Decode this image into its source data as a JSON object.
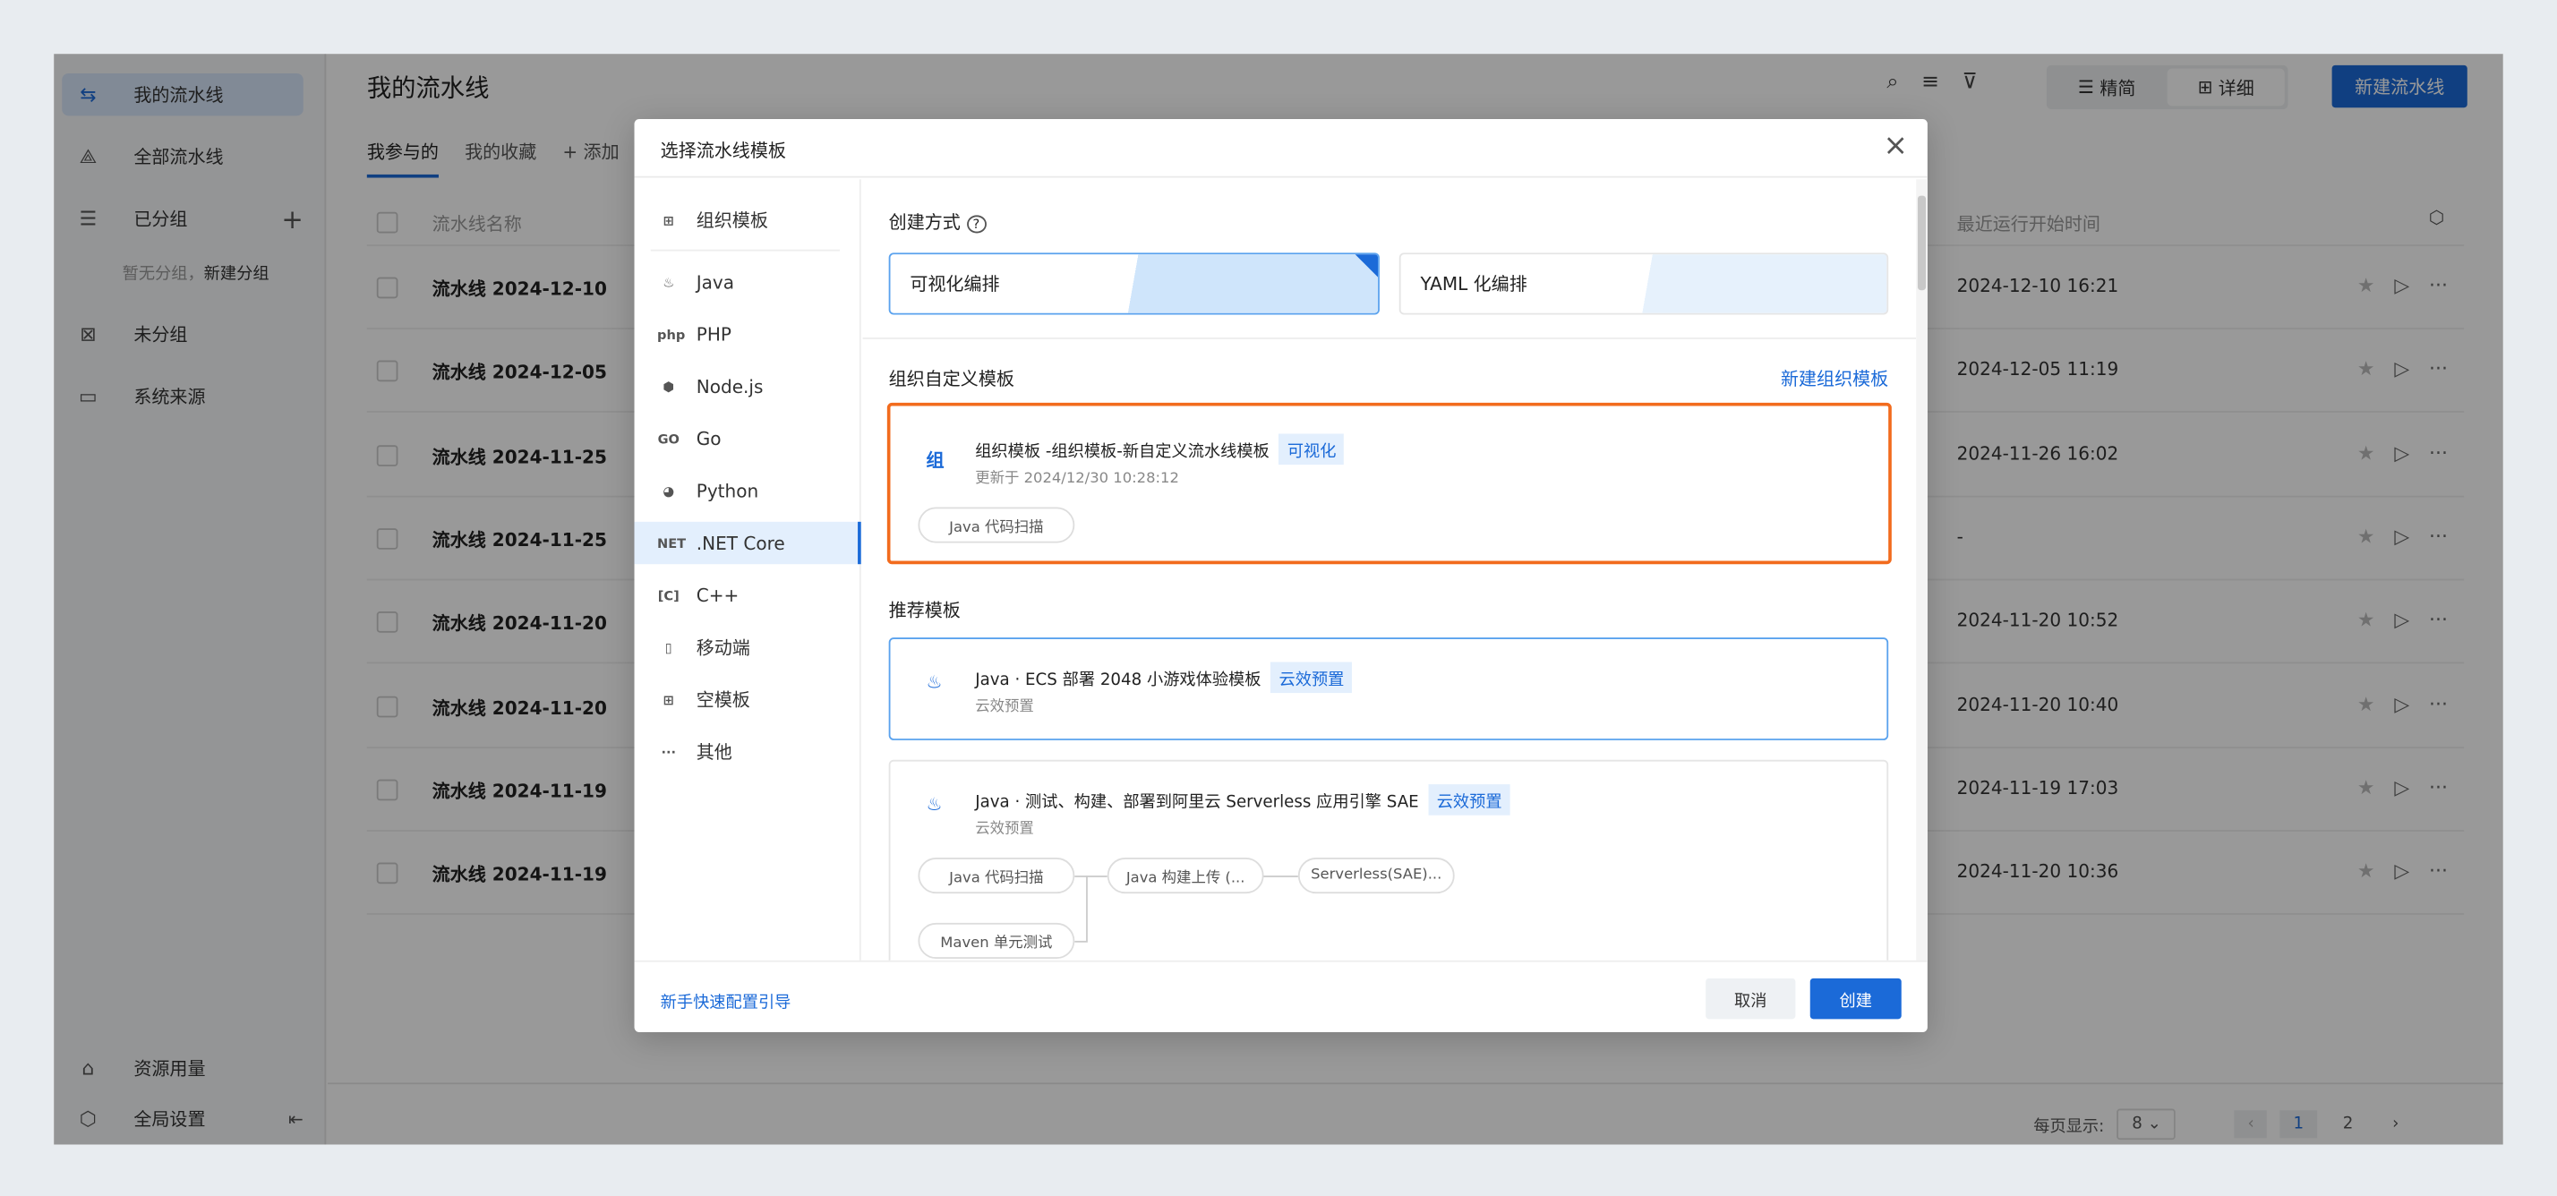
{
  "sidebar": {
    "items": [
      {
        "label": "我的流水线",
        "icon": "pipeline-icon",
        "glyph": "⇆",
        "active": true
      },
      {
        "label": "全部流水线",
        "icon": "triangle-nodes-icon",
        "glyph": "⟁"
      },
      {
        "label": "已分组",
        "icon": "group-list-icon",
        "glyph": "☰"
      },
      {
        "label": "未分组",
        "icon": "ungrouped-icon",
        "glyph": "⊠"
      },
      {
        "label": "系统来源",
        "icon": "monitor-icon",
        "glyph": "▭"
      }
    ],
    "no_group_text": "暂无分组，",
    "new_group_link": "新建分组",
    "bottom": [
      {
        "label": "资源用量",
        "icon": "inbox-icon",
        "glyph": "⌂"
      },
      {
        "label": "全局设置",
        "icon": "settings-icon",
        "glyph": "⬡"
      }
    ]
  },
  "header": {
    "title": "我的流水线",
    "tabs": [
      "我参与的",
      "我的收藏"
    ],
    "add_label": "添加",
    "view_simple": "精简",
    "view_detail": "详细",
    "new_button": "新建流水线"
  },
  "table": {
    "col_name": "流水线名称",
    "col_time": "最近运行开始时间",
    "rows": [
      {
        "name": "流水线 2024-12-10",
        "time": "2024-12-10 16:21"
      },
      {
        "name": "流水线 2024-12-05",
        "time": "2024-12-05 11:19"
      },
      {
        "name": "流水线 2024-11-25",
        "time": "2024-11-26 16:02"
      },
      {
        "name": "流水线 2024-11-25",
        "time": "-"
      },
      {
        "name": "流水线 2024-11-20",
        "time": "2024-11-20 10:52"
      },
      {
        "name": "流水线 2024-11-20",
        "time": "2024-11-20 10:40"
      },
      {
        "name": "流水线 2024-11-19",
        "time": "2024-11-19 17:03"
      },
      {
        "name": "流水线 2024-11-19",
        "time": "2024-11-20 10:36"
      }
    ]
  },
  "pagination": {
    "per_page_label": "每页显示:",
    "per_page": "8",
    "pages": [
      "1",
      "2"
    ],
    "current": "1"
  },
  "modal": {
    "title": "选择流水线模板",
    "nav": [
      {
        "label": "组织模板",
        "glyph": "⊞"
      },
      {
        "label": "Java",
        "glyph": "♨"
      },
      {
        "label": "PHP",
        "glyph": "php"
      },
      {
        "label": "Node.js",
        "glyph": "⬢"
      },
      {
        "label": "Go",
        "glyph": "GO"
      },
      {
        "label": "Python",
        "glyph": "◕"
      },
      {
        "label": ".NET Core",
        "glyph": "NET",
        "active": true
      },
      {
        "label": "C++",
        "glyph": "[C]"
      },
      {
        "label": "移动端",
        "glyph": "▯"
      },
      {
        "label": "空模板",
        "glyph": "⊞"
      },
      {
        "label": "其他",
        "glyph": "···"
      }
    ],
    "create_mode_label": "创建方式",
    "modes": [
      "可视化编排",
      "YAML 化编排"
    ],
    "org_section": "组织自定义模板",
    "new_org_template": "新建组织模板",
    "org_template": {
      "icon_char": "组",
      "name": "组织模板 -组织模板-新自定义流水线模板",
      "badge": "可视化",
      "updated": "更新于 2024/12/30 10:28:12",
      "steps": [
        "Java 代码扫描"
      ]
    },
    "recommended_section": "推荐模板",
    "recommended": [
      {
        "name": "Java · ECS 部署 2048 小游戏体验模板",
        "badge": "云效预置",
        "sub": "云效预置"
      },
      {
        "name": "Java · 测试、构建、部署到阿里云 Serverless 应用引擎 SAE",
        "badge": "云效预置",
        "sub": "云效预置",
        "steps": [
          "Java 代码扫描",
          "Java 构建上传 (...",
          "Serverless(SAE)...",
          "Maven 单元测试"
        ]
      }
    ],
    "guide_link": "新手快速配置引导",
    "cancel": "取消",
    "create": "创建"
  },
  "colors": {
    "accent": "#1b6ad8",
    "highlight_border": "#f26b1d"
  }
}
